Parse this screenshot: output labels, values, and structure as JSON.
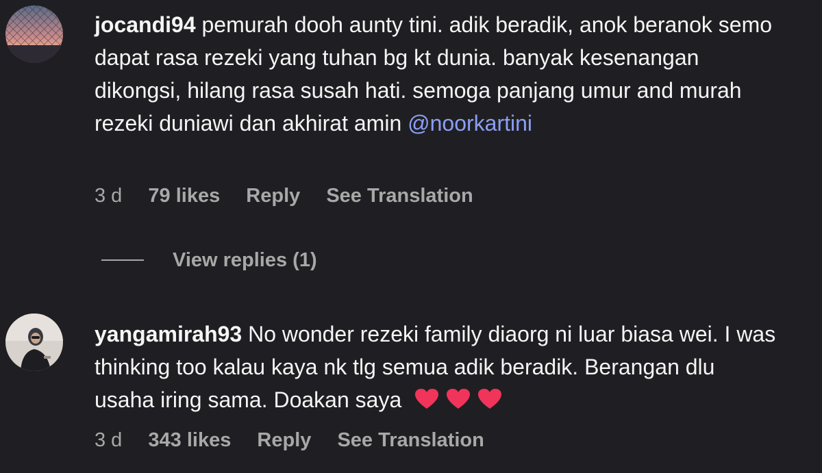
{
  "comments": [
    {
      "username": "jocandi94",
      "text": " pemurah dooh aunty tini. adik beradik, anok beranok semo dapat rasa rezeki yang tuhan bg kt dunia. banyak kesenangan dikongsi, hilang rasa susah hati. semoga panjang umur and murah rezeki duniawi dan akhirat amin ",
      "mention": "@noorkartini",
      "time": "3 d",
      "likes": "79 likes",
      "reply_label": "Reply",
      "translate_label": "See Translation",
      "view_replies": "View replies (1)"
    },
    {
      "username": "yangamirah93",
      "text": " No wonder rezeki family diaorg ni luar biasa wei. I was thinking too kalau kaya nk tlg semua adik beradik. Berangan dlu usaha iring sama. Doakan saya",
      "emoji": [
        "heart-icon",
        "heart-icon",
        "heart-icon"
      ],
      "time": "3 d",
      "likes": "343 likes",
      "reply_label": "Reply",
      "translate_label": "See Translation"
    }
  ],
  "colors": {
    "background": "#1f1f23",
    "text": "#f5f5f5",
    "muted": "#a8a8a8",
    "mention": "#8c9ff5",
    "heart": "#f0345a"
  }
}
